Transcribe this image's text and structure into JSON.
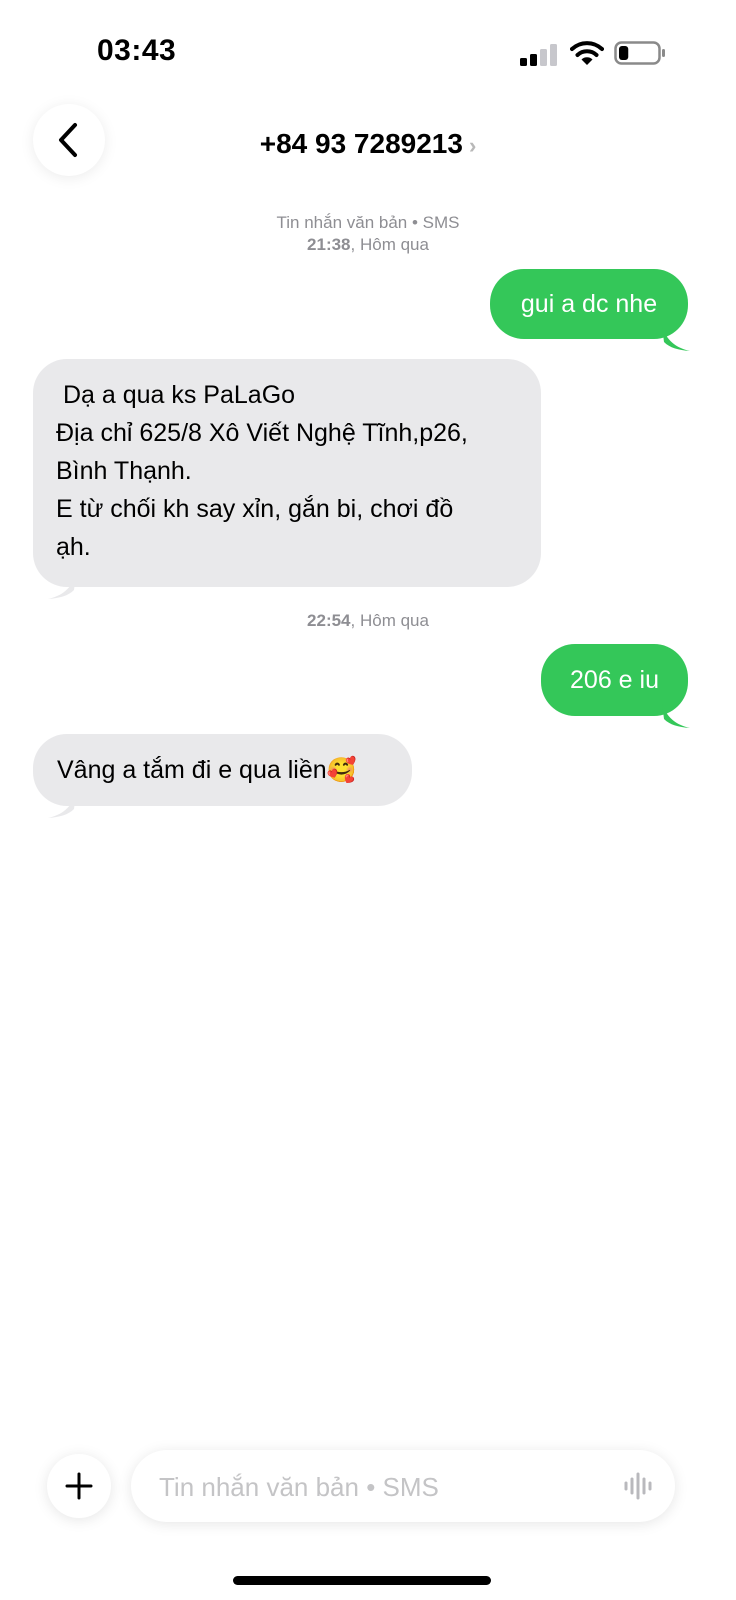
{
  "status_bar": {
    "time": "03:43",
    "battery_level": 0.25
  },
  "header": {
    "contact_number": "+84 93 7289213",
    "back_icon": "chevron-left-icon",
    "contact_chevron": "›"
  },
  "conversation": {
    "first_meta": {
      "service": "Tin nhắn văn bản • SMS",
      "time": "21:38",
      "day": "Hôm qua"
    },
    "second_meta": {
      "time": "22:54",
      "day": "Hôm qua"
    },
    "messages": [
      {
        "direction": "outgoing",
        "text": "gui a dc nhe"
      },
      {
        "direction": "incoming",
        "lines": [
          " Dạ a qua ks PaLaGo",
          "Địa chỉ 625/8 Xô Viết Nghệ Tĩnh,p26,",
          "Bình Thạnh.",
          "E từ chối kh say xỉn, gắn bi, chơi đồ",
          "ạh."
        ]
      },
      {
        "direction": "outgoing",
        "text": "206 e iu"
      },
      {
        "direction": "incoming",
        "text": "Vâng a tắm đi e qua liền",
        "emoji": "🥰"
      }
    ]
  },
  "composer": {
    "placeholder": "Tin nhắn văn bản • SMS",
    "plus_icon": "plus-icon",
    "voice_icon": "waveform-icon"
  },
  "colors": {
    "outgoing_bubble": "#34c759",
    "incoming_bubble": "#e9e9eb",
    "meta_text": "#8e8e93"
  }
}
